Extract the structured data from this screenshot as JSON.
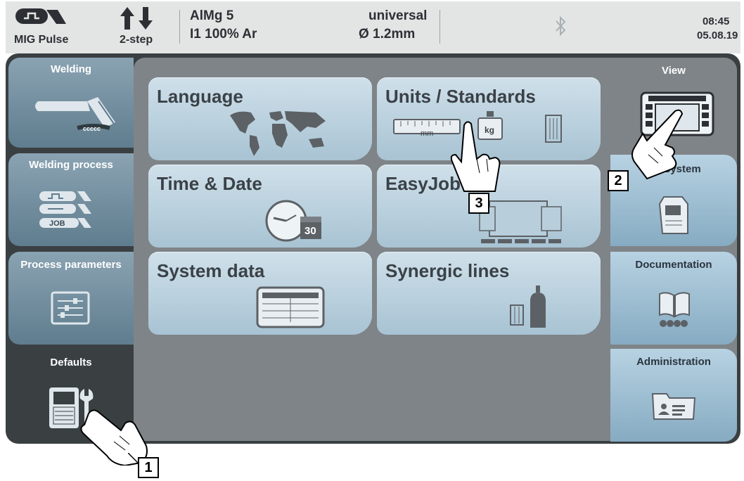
{
  "status_bar": {
    "process": "MIG Pulse",
    "mode": "2-step",
    "material": "AlMg 5",
    "gas": "I1 100% Ar",
    "characteristic": "universal",
    "wire_diameter": "Ø  1.2mm",
    "time": "08:45",
    "date": "05.08.19",
    "icons": [
      "mig-pulse-torch-icon",
      "mode-arrows-icon",
      "bluetooth-icon"
    ]
  },
  "left_nav": [
    {
      "label": "Welding",
      "icon": "welding-torch-icon"
    },
    {
      "label": "Welding process",
      "icon": "process-icon"
    },
    {
      "label": "Process parameters",
      "icon": "sliders-icon"
    },
    {
      "label": "Defaults",
      "icon": "power-source-wrench-icon",
      "active": true
    }
  ],
  "job_badge": "JOB",
  "tiles": [
    {
      "label": "Language",
      "icon": "world-map-icon"
    },
    {
      "label": "Units / Standards",
      "icon": "units-icon",
      "unit_mm": "mm",
      "unit_kg": "kg"
    },
    {
      "label": "Time & Date",
      "icon": "clock-calendar-icon",
      "calendar_day": "30"
    },
    {
      "label": "EasyJob",
      "icon": "easyjob-icon"
    },
    {
      "label": "System data",
      "icon": "data-table-icon"
    },
    {
      "label": "Synergic lines",
      "icon": "wire-gas-icon"
    }
  ],
  "right_nav": [
    {
      "label": "View",
      "icon": "display-icon",
      "active": true
    },
    {
      "label": "System",
      "icon": "system-device-icon"
    },
    {
      "label": "Documentation",
      "icon": "book-icon"
    },
    {
      "label": "Administration",
      "icon": "user-folder-icon"
    }
  ],
  "callouts": [
    "1",
    "2",
    "3"
  ]
}
